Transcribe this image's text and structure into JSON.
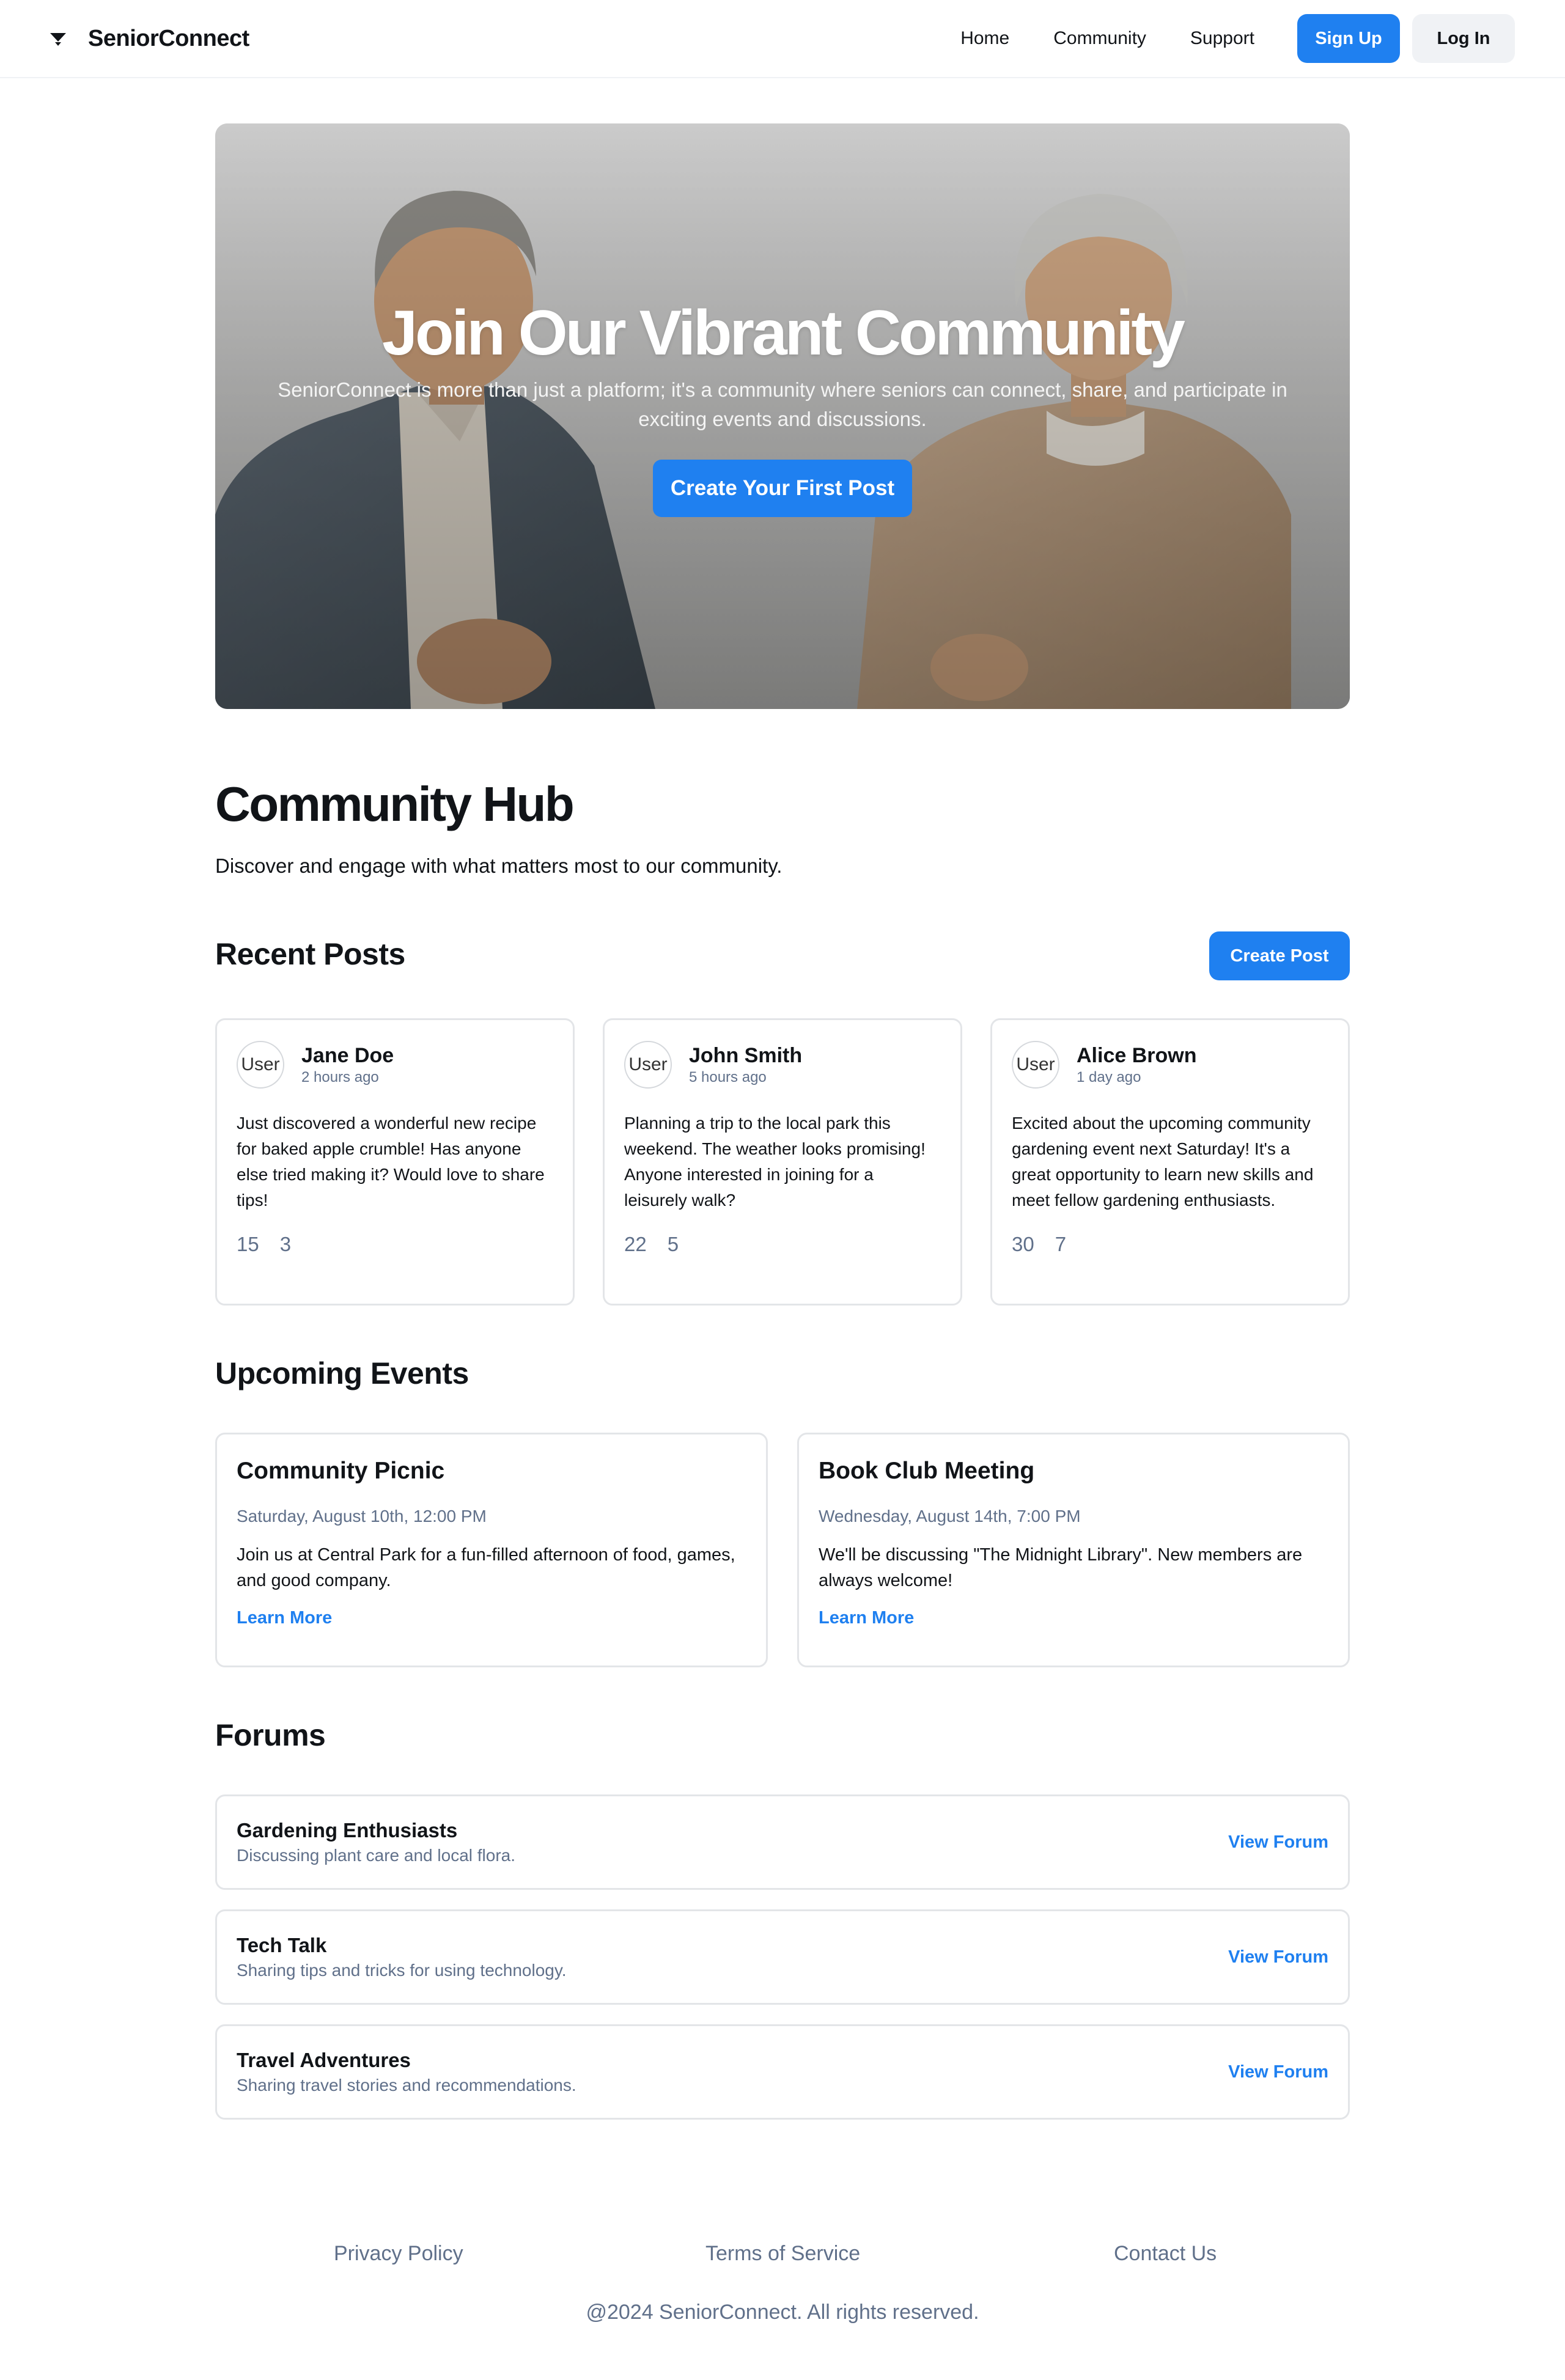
{
  "header": {
    "brand": "SeniorConnect",
    "nav": [
      "Home",
      "Community",
      "Support"
    ],
    "signup_label": "Sign Up",
    "login_label": "Log In"
  },
  "hero": {
    "title": "Join Our Vibrant Community",
    "subtitle": "SeniorConnect is more than just a platform; it's a community where seniors can connect, share, and participate in exciting events and discussions.",
    "cta": "Create Your First Post"
  },
  "hub": {
    "title": "Community Hub",
    "subtitle": "Discover and engage with what matters most to our community."
  },
  "recent_posts": {
    "title": "Recent Posts",
    "create_label": "Create Post",
    "posts": [
      {
        "avatar_alt": "User",
        "author": "Jane Doe",
        "time": "2 hours ago",
        "body": "Just discovered a wonderful new recipe for baked apple crumble! Has anyone else tried making it? Would love to share tips!",
        "likes": "15",
        "comments": "3"
      },
      {
        "avatar_alt": "User",
        "author": "John Smith",
        "time": "5 hours ago",
        "body": "Planning a trip to the local park this weekend. The weather looks promising! Anyone interested in joining for a leisurely walk?",
        "likes": "22",
        "comments": "5"
      },
      {
        "avatar_alt": "User",
        "author": "Alice Brown",
        "time": "1 day ago",
        "body": "Excited about the upcoming community gardening event next Saturday! It's a great opportunity to learn new skills and meet fellow gardening enthusiasts.",
        "likes": "30",
        "comments": "7"
      }
    ]
  },
  "events": {
    "title": "Upcoming Events",
    "items": [
      {
        "title": "Community Picnic",
        "date": "Saturday, August 10th, 12:00 PM",
        "description": "Join us at Central Park for a fun-filled afternoon of food, games, and good company.",
        "link": "Learn More"
      },
      {
        "title": "Book Club Meeting",
        "date": "Wednesday, August 14th, 7:00 PM",
        "description": "We'll be discussing \"The Midnight Library\". New members are always welcome!",
        "link": "Learn More"
      }
    ]
  },
  "forums": {
    "title": "Forums",
    "items": [
      {
        "name": "Gardening Enthusiasts",
        "description": "Discussing plant care and local flora.",
        "link": "View Forum"
      },
      {
        "name": "Tech Talk",
        "description": "Sharing tips and tricks for using technology.",
        "link": "View Forum"
      },
      {
        "name": "Travel Adventures",
        "description": "Sharing travel stories and recommendations.",
        "link": "View Forum"
      }
    ]
  },
  "footer": {
    "links": [
      "Privacy Policy",
      "Terms of Service",
      "Contact Us"
    ],
    "copyright": "@2024 SeniorConnect. All rights reserved."
  },
  "colors": {
    "accent": "#1f80f0",
    "muted_text": "#60708a",
    "border": "#e3e5e8"
  }
}
